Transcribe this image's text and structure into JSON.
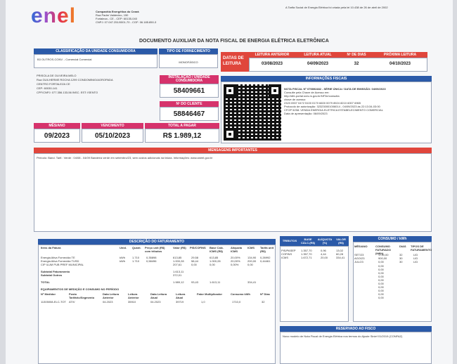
{
  "header": {
    "logo": "enel",
    "company_lines": [
      "Companhia Energética do Ceará",
      "Rua Padre Valdevino, 150",
      "Fortaleza - CE - CEP: 60135-040",
      "CNPJ: 07.047.251/0001-70 - CGF: 06.185.850-3"
    ],
    "top_note": "A Tarifa Social de Energia Elétrica foi criada pela lei 10.438 de 26 de abril de 2002"
  },
  "doc_title": "DOCUMENTO AUXILIAR DA NOTA FISCAL DE ENERGIA ELÉTRICA ELETRÔNICA",
  "classificacao": {
    "label": "CLASSIFICAÇÃO DA UNIDADE CONSUMIDORA",
    "value": "B3 OUTROS-CONV. - Comercial Comercial"
  },
  "tipo_fornecimento": {
    "label": "TIPO DE FORNECIMENTO",
    "value": "MONOFÁSICO"
  },
  "leitura": {
    "title": "DATAS DE LEITURA",
    "labels": [
      "LEITURA ANTERIOR",
      "LEITURA ATUAL",
      "Nº DE DIAS",
      "PRÓXIMA LEITURA"
    ],
    "values": [
      "03/08/2023",
      "04/09/2023",
      "32",
      "04/10/2023"
    ]
  },
  "cliente": {
    "name": "PRISCILA DE OLIVEIRA MELO",
    "address": "Rua GUILHERME ROCHA 1299 CONDOMINIO/AGROPADA",
    "city": "CENTRO FORTALEZA CE",
    "cep": "CEP: 60030-141",
    "doc": "CPF/CNPJ: 077.356.133-56 INSC. EST: ISENTO"
  },
  "instalacao": {
    "label": "INSTALAÇÃO / UNIDADE CONSUMIDORA",
    "value": "58409661"
  },
  "nr_cliente": {
    "label": "Nº DO CLIENTE",
    "value": "58846467"
  },
  "informacoes_fiscais": {
    "label": "INFORMAÇÕES FISCAIS",
    "nota": "NOTA FISCAL Nº 079892482 - SÉRIE ÚNICA / DATA DE EMISSÃO: 04/09/2023",
    "lines": [
      "Consulte pela Chave de Acesso em:",
      "http://dfe-portal.svrs.rs.gov.br/NF3e/consulta",
      "chave de acesso:",
      "2323 0907 0472 5100 0170 6600 0079 8924 8210 6007 6965",
      "Protocolo de autorização: 323230001006014 - 04/09/2023 às 22:13:34-03:00",
      "CFOP 5258: VENDA ENERGIA ELETRICA ESTABELECIMENTO COMERCIAL",
      "Data de apresentação: 06/09/2023"
    ]
  },
  "resumo": {
    "labels": [
      "MÊS/ANO",
      "VENCIMENTO",
      "TOTAL A PAGAR"
    ],
    "values": [
      "09/2023",
      "05/10/2023",
      "R$ 1.989,12"
    ]
  },
  "mensagens": {
    "label": "MENSAGENS IMPORTANTES",
    "text": "Período: Band. Tarif.: Verde : 04/08 - 04/09 Bandeira verde em setembro/23, sem custos adicionais na fatura. Informações: www.aneel.gov.br"
  },
  "faturamento": {
    "label": "DESCRIÇÃO DO FATURAMENTO",
    "headers": [
      "Itens da Fatura",
      "Unid.",
      "Quant.",
      "Preço unit (R$) com tributos",
      "Valor (R$)",
      "PIS/COFINS",
      "Base Calc. ICMS (R$)",
      "Alíquota ICMS",
      "ICMS",
      "Tarifa unit (R$)"
    ],
    "rows": [
      [
        "Energia Ativa Fornecida TE",
        "kWh",
        "1.710",
        "0,35898",
        "613,85",
        "29,58",
        "613,85",
        "20,00%",
        "134,90",
        "0,26992"
      ],
      [
        "Energia Ativa Fornecida TUSD",
        "kWh",
        "1.710",
        "0,58496",
        "1.000,28",
        "58,44",
        "1.000,28",
        "20,00%",
        "200,00",
        "0,44461"
      ],
      [
        "CIP ILUM PUB PREF MUNICIPAL",
        "",
        "",
        "",
        "207,61",
        "0,00",
        "0,00",
        "0,00%",
        "0,00",
        ""
      ]
    ],
    "subtotal_fat_label": "Subtotal Faturamento",
    "subtotal_fat": "1.613,11",
    "subtotal_outros_label": "Subtotal Outros",
    "subtotal_outros": "372,01",
    "total_label": "TOTAL",
    "total": "1.989,12",
    "total_pis": "93,43",
    "total_base": "1.613,11",
    "total_icms": "334,41",
    "equip_label": "EQUIPAMENTOS DE MEDIÇÃO E CONSUMO NO PERÍODO",
    "equip_headers": [
      "Nº Medidor",
      "Posto Tarifário/Segmento",
      "Data Leitura Anterior",
      "Leitura Anterior",
      "Data Leitura Atual",
      "Leitura Atual",
      "Fator Multiplicador",
      "Consumo kWh",
      "Nº Dias"
    ],
    "equip_row": [
      "11305008-ELC-TOT",
      "ATIV",
      "04.2023",
      "35910",
      "04.2023",
      "39719",
      "1,0",
      "1710,0",
      "32"
    ]
  },
  "tributos": {
    "headers": [
      "TRIBUTOS",
      "BASE CÁLC.(R$)",
      "ALÍQUOTA (%)",
      "VALOR (R$)"
    ],
    "rows": [
      [
        "PIS/PASEP",
        "1.357,70",
        "0,96",
        "13,02"
      ],
      [
        "COFINS",
        "1.357,70",
        "4,44",
        "60,28"
      ],
      [
        "ICMS",
        "1.672,71",
        "20,00",
        "334,41"
      ]
    ]
  },
  "consumo": {
    "label": "CONSUMO / kWh",
    "headers": [
      "MÊS/ANO",
      "CONSUMO FATURADO (kWh)",
      "DIAS",
      "TIPOS DE FATURAMENTO"
    ],
    "rows": [
      [
        "SET/23",
        "1710,00",
        "32",
        "LID"
      ],
      [
        "AGO/23",
        "900,00",
        "30",
        "LID"
      ],
      [
        "JUL/23",
        "0,00",
        "30",
        "LID"
      ]
    ],
    "zeros": [
      "0,00",
      "0,00",
      "0,00",
      "0,00",
      "0,00",
      "0,00",
      "0,00",
      "0,00",
      "0,00",
      "0,00"
    ]
  },
  "reservado": {
    "label": "RESERVADO AO FISCO",
    "text": "Novo modelo de Nota Fiscal de Energia Elétrica nos termos do Ajuste Sinief 01/2019 (CONFAZ)"
  }
}
